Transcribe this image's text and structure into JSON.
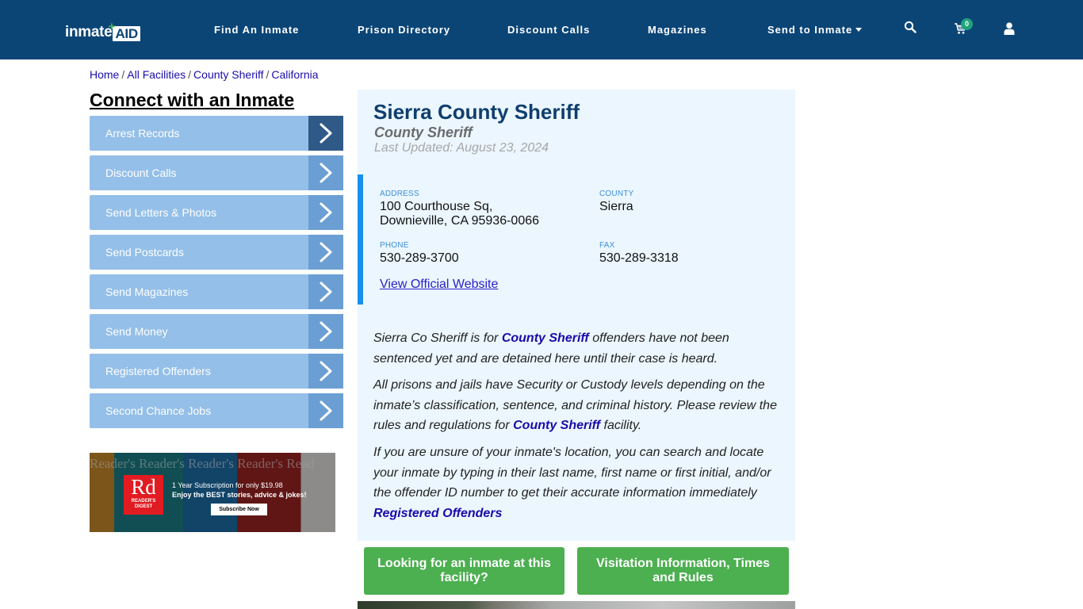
{
  "header": {
    "logo": {
      "part1": "inmate",
      "part2": "AID",
      "plus": "+"
    },
    "nav": [
      {
        "label": "Find An Inmate"
      },
      {
        "label": "Prison Directory"
      },
      {
        "label": "Discount Calls"
      },
      {
        "label": "Magazines"
      },
      {
        "label": "Send to Inmate",
        "has_dropdown": true
      }
    ],
    "icons": {
      "search": "search-icon",
      "cart": "cart-icon",
      "user": "user-icon"
    },
    "cart_count": "0",
    "colors": {
      "bar": "#0b4576",
      "badge": "#1ea47b"
    }
  },
  "breadcrumb": [
    {
      "label": "Home"
    },
    {
      "label": "All Facilities"
    },
    {
      "label": "County Sheriff"
    },
    {
      "label": "California"
    }
  ],
  "sidebar": {
    "title": "Connect with an Inmate",
    "items": [
      {
        "label": "Arrest Records"
      },
      {
        "label": "Discount Calls"
      },
      {
        "label": "Send Letters & Photos"
      },
      {
        "label": "Send Postcards"
      },
      {
        "label": "Send Magazines"
      },
      {
        "label": "Send Money"
      },
      {
        "label": "Registered Offenders"
      },
      {
        "label": "Second Chance Jobs"
      }
    ],
    "ad": {
      "logo_big": "Rd",
      "logo_small_1": "READER'S",
      "logo_small_2": "DIGEST",
      "line1": "1 Year Subscription for only $19.98",
      "line2": "Enjoy the BEST stories, advice & jokes!",
      "cta": "Subscribe Now",
      "cover_text": "Reader's   Reader's   Reader's   Reader's   Read"
    }
  },
  "facility": {
    "name": "Sierra County Sheriff",
    "type": "County Sheriff",
    "last_updated": "Last Updated: August 23, 2024",
    "address_label": "Address",
    "address_line1": "100 Courthouse Sq,",
    "address_line2": "Downieville, CA 95936-0066",
    "county_label": "County",
    "county": "Sierra",
    "phone_label": "Phone",
    "phone": "530-289-3700",
    "fax_label": "Fax",
    "fax": "530-289-3318",
    "website_link": "View Official Website"
  },
  "description": {
    "p1_a": "Sierra Co Sheriff is for ",
    "p1_link": "County Sheriff",
    "p1_b": " offenders have not been sentenced yet and are detained here until their case is heard.",
    "p2_a": "All prisons and jails have Security or Custody levels depending on the inmate’s classification, sentence, and criminal history. Please review the rules and regulations for ",
    "p2_link": "County Sheriff",
    "p2_b": " facility.",
    "p3": "If you are unsure of your inmate's location, you can search and locate your inmate by typing in their last name, first name or first initial, and/or the offender ID number to get their accurate information immediately",
    "p3_link": "Registered Offenders"
  },
  "actions": {
    "find_inmate": "Looking for an inmate at this facility?",
    "visitation": "Visitation Information, Times and Rules"
  }
}
